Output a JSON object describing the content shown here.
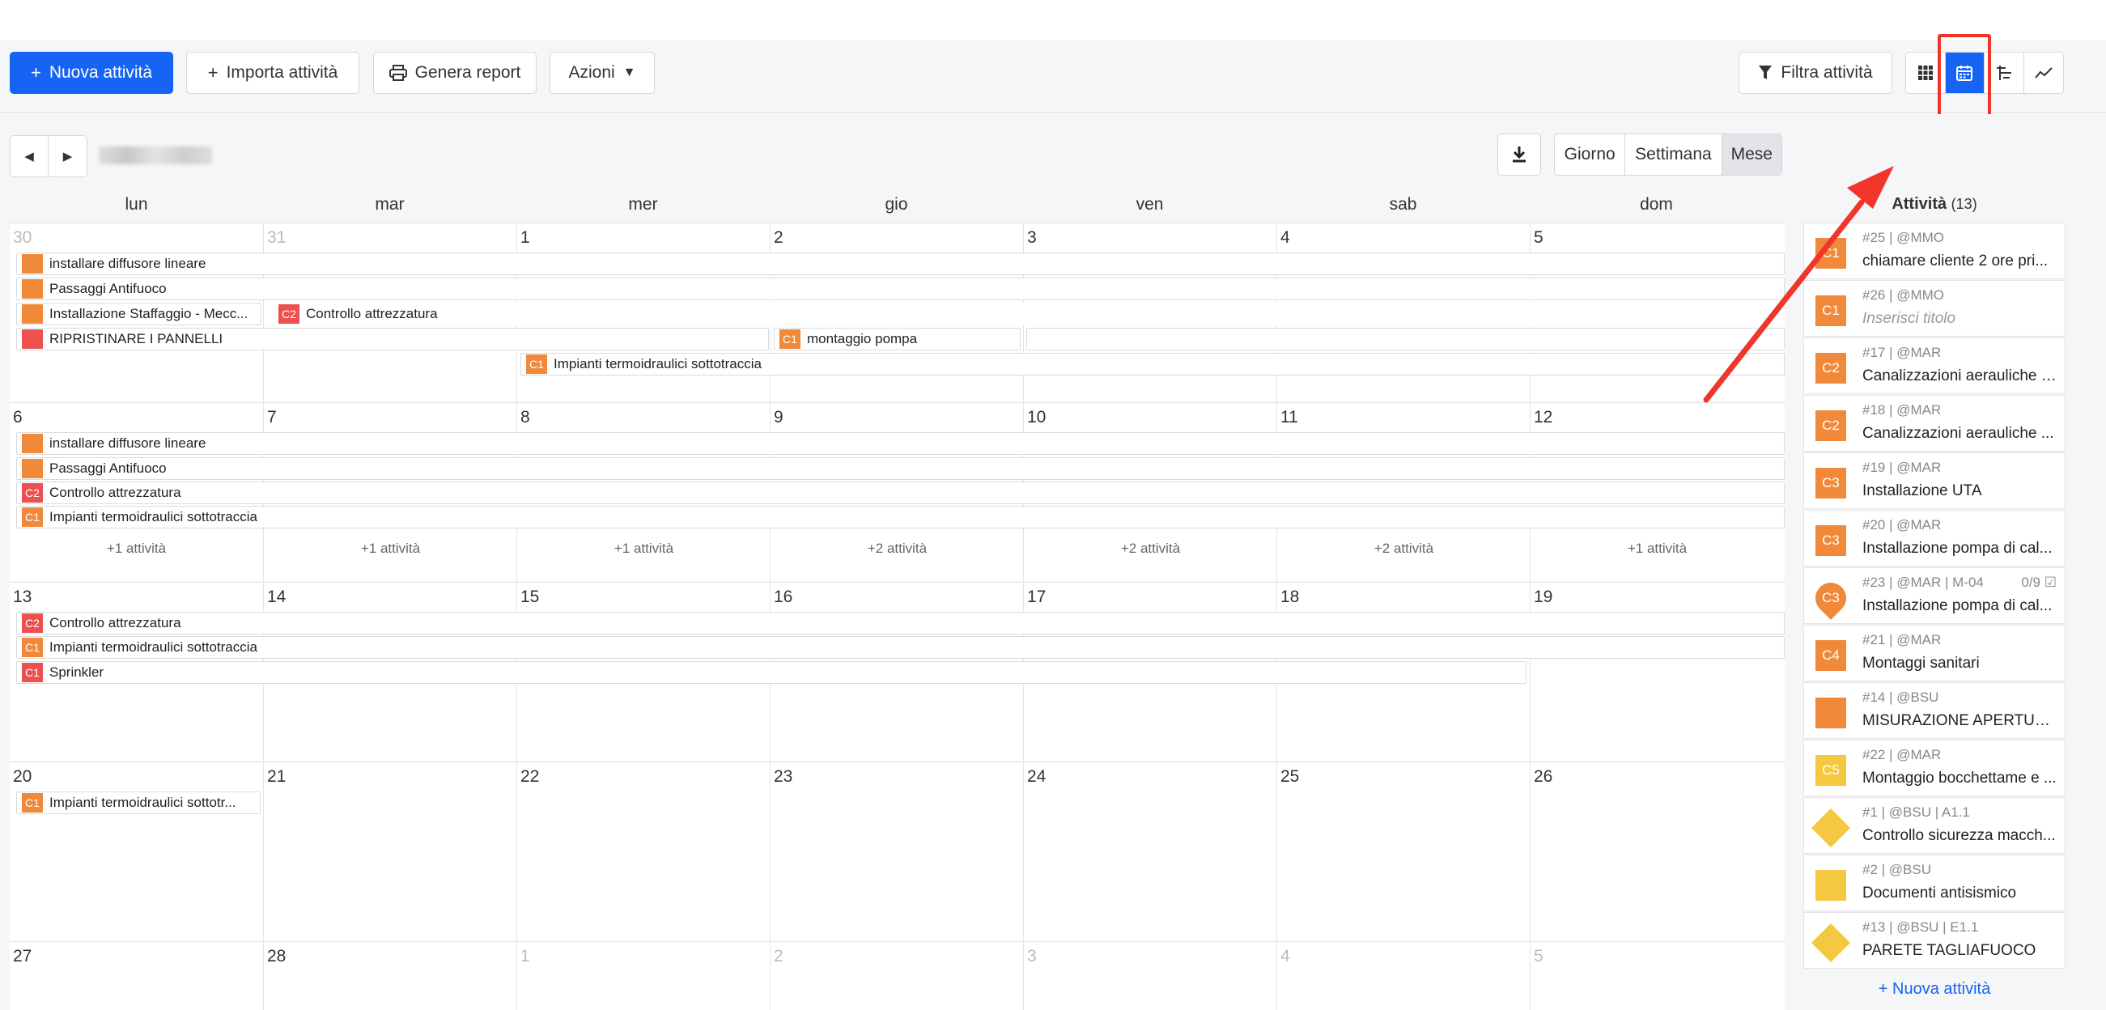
{
  "toolbar": {
    "new_activity": "Nuova attività",
    "import_activity": "Importa attività",
    "generate_report": "Genera report",
    "actions": "Azioni",
    "filter": "Filtra attività"
  },
  "calendar": {
    "views": [
      "Giorno",
      "Settimana",
      "Mese"
    ],
    "active_view": "Mese",
    "weekdays": [
      "lun",
      "mar",
      "mer",
      "gio",
      "ven",
      "sab",
      "dom"
    ],
    "weeks": [
      {
        "days": [
          "30",
          "31",
          "1",
          "2",
          "3",
          "4",
          "5"
        ],
        "more": []
      },
      {
        "days": [
          "6",
          "7",
          "8",
          "9",
          "10",
          "11",
          "12"
        ],
        "more": [
          "+1 attività",
          "+1 attività",
          "+1 attività",
          "+2 attività",
          "+2 attività",
          "+2 attività",
          "+1 attività"
        ]
      },
      {
        "days": [
          "13",
          "14",
          "15",
          "16",
          "17",
          "18",
          "19"
        ],
        "more": []
      },
      {
        "days": [
          "20",
          "21",
          "22",
          "23",
          "24",
          "25",
          "26"
        ],
        "more": []
      },
      {
        "days": [
          "27",
          "28",
          "1",
          "2",
          "3",
          "4",
          "5"
        ],
        "more": []
      }
    ],
    "events": {
      "w1_e1": {
        "label": "installare diffusore lineare",
        "tag": ""
      },
      "w1_e2": {
        "label": "Passaggi Antifuoco",
        "tag": ""
      },
      "w1_e3": {
        "label": "Installazione Staffaggio - Mecc...",
        "tag": ""
      },
      "w1_e4": {
        "label": "Controllo attrezzatura",
        "tag": "C2"
      },
      "w1_e5": {
        "label": "RIPRISTINARE I PANNELLI",
        "tag": ""
      },
      "w1_e6": {
        "label": "montaggio pompa",
        "tag": "C1"
      },
      "w1_e7": {
        "label": "Impianti termoidraulici sottotraccia",
        "tag": "C1"
      },
      "w2_e1": {
        "label": "installare diffusore lineare",
        "tag": ""
      },
      "w2_e2": {
        "label": "Passaggi Antifuoco",
        "tag": ""
      },
      "w2_e3": {
        "label": "Controllo attrezzatura",
        "tag": "C2"
      },
      "w2_e4": {
        "label": "Impianti termoidraulici sottotraccia",
        "tag": "C1"
      },
      "w3_e1": {
        "label": "Controllo attrezzatura",
        "tag": "C2"
      },
      "w3_e2": {
        "label": "Impianti termoidraulici sottotraccia",
        "tag": "C1"
      },
      "w3_e3": {
        "label": "Sprinkler",
        "tag": "C1"
      },
      "w4_e1": {
        "label": "Impianti termoidraulici sottotr...",
        "tag": "C1"
      }
    }
  },
  "sidebar": {
    "title": "Attività",
    "count": "(13)",
    "items": [
      {
        "meta": "#25 | @MMO",
        "name": "chiamare cliente 2 ore pri...",
        "tag": "C1",
        "color": "#f08a3a"
      },
      {
        "meta": "#26 | @MMO",
        "name": "Inserisci titolo",
        "tag": "C1",
        "color": "#f08a3a"
      },
      {
        "meta": "#17 | @MAR",
        "name": "Canalizzazioni aerauliche r...",
        "tag": "C2",
        "color": "#f08a3a"
      },
      {
        "meta": "#18 | @MAR",
        "name": "Canalizzazioni aerauliche ...",
        "tag": "C2",
        "color": "#f08a3a"
      },
      {
        "meta": "#19 | @MAR",
        "name": "Installazione UTA",
        "tag": "C3",
        "color": "#f08a3a"
      },
      {
        "meta": "#20 | @MAR",
        "name": "Installazione pompa di cal...",
        "tag": "C3",
        "color": "#f08a3a"
      },
      {
        "meta": "#23 | @MAR | M-04",
        "name": "Installazione pompa di cal...",
        "tag": "C3",
        "color": "#f08a3a",
        "progress": "0/9"
      },
      {
        "meta": "#21 | @MAR",
        "name": "Montaggi sanitari",
        "tag": "C4",
        "color": "#f08a3a"
      },
      {
        "meta": "#14 | @BSU",
        "name": "MISURAZIONE APERTUR...",
        "tag": "",
        "color": "#f08a3a"
      },
      {
        "meta": "#22 | @MAR",
        "name": "Montaggio bocchettame e ...",
        "tag": "C5",
        "color": "#f5c842"
      },
      {
        "meta": "#1 | @BSU | A1.1",
        "name": "Controllo sicurezza macch...",
        "tag": "",
        "color": "#f5c842"
      },
      {
        "meta": "#2 | @BSU",
        "name": "Documenti antisismico",
        "tag": "",
        "color": "#f5c842"
      },
      {
        "meta": "#13 | @BSU | E1.1",
        "name": "PARETE TAGLIAFUOCO",
        "tag": "",
        "color": "#f5c842"
      }
    ],
    "add_link": "+ Nuova attività"
  },
  "colors": {
    "primary": "#1764f4",
    "orange": "#f08a3a",
    "red": "#ee5050",
    "yellow": "#f5c842",
    "highlight": "#f0362a"
  },
  "icons": [
    "plus-icon",
    "printer-icon",
    "filter-icon",
    "grid-icon",
    "calendar-icon",
    "gantt-icon",
    "chart-icon",
    "download-icon",
    "chevron-left-icon",
    "chevron-right-icon"
  ]
}
